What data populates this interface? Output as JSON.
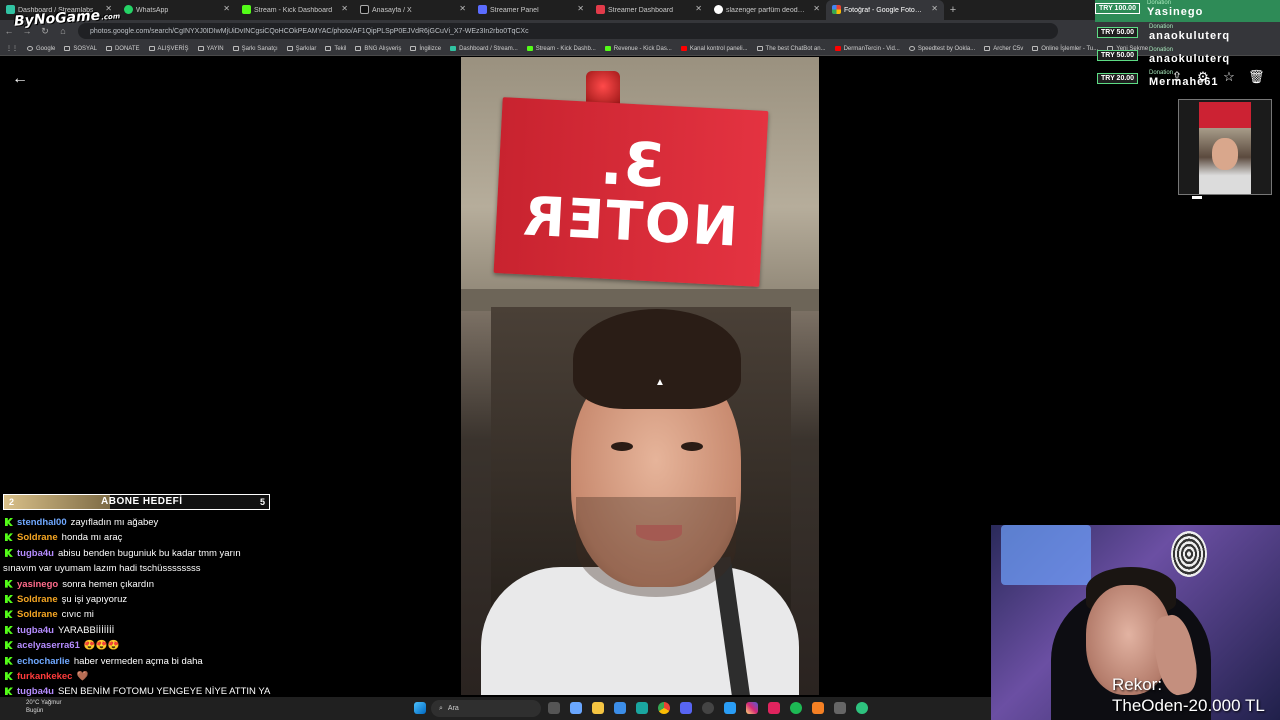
{
  "browser": {
    "tabs": [
      {
        "label": "Dashboard / Streamlabs",
        "icon": "streamlabs-icon",
        "color": "#31c3a2"
      },
      {
        "label": "WhatsApp",
        "icon": "whatsapp-icon",
        "color": "#25d366"
      },
      {
        "label": "Stream - Kick Dashboard",
        "icon": "kick-icon",
        "color": "#53fc18"
      },
      {
        "label": "Anasayfa / X",
        "icon": "x-icon",
        "color": "#ffffff"
      },
      {
        "label": "Streamer Panel",
        "icon": "panel-icon",
        "color": "#5b6cff"
      },
      {
        "label": "Streamer Dashboard",
        "icon": "dashboard-icon",
        "color": "#e23b4a"
      },
      {
        "label": "slazenger parfüm deodorant y",
        "icon": "google-icon",
        "color": "#8ab4f8"
      },
      {
        "label": "Fotoğraf - Google Fotoğraflar",
        "icon": "photos-icon",
        "color": "#fbbc04",
        "active": true
      }
    ],
    "url": "photos.google.com/search/CgINYXJ0IDIwMjUiDvINCgsiCQoHCOkPEAMYAC/photo/AF1QipPLSpP0EJVdR6jGCuVi_X7-WEz3In2rbo0TqCXc",
    "bookmarks": [
      "Google",
      "SOSYAL",
      "DONATE",
      "ALIŞVERİŞ",
      "YAYIN",
      "Şarkı Sanatçı",
      "Şarkılar",
      "Tekil",
      "BNG Alışveriş",
      "İngilizce",
      "Dashboard / Stream...",
      "Stream - Kick Dashb...",
      "Revenue - Kick Das...",
      "Kanal kontrol paneli...",
      "The best ChatBot an...",
      "DermanTercin - Vid...",
      "Speedtest by Ookla...",
      "Archer C5v",
      "Online İşlemler - Tu...",
      "Yeni Sekme"
    ]
  },
  "photo": {
    "sign_number": "3.",
    "sign_word": "NOTER"
  },
  "overlay": {
    "logo": "ByNoGame",
    "logo_sub": ".com",
    "donations": [
      {
        "amount": "TRY 100.00",
        "tag": "Donation",
        "name": "Yasinego"
      },
      {
        "amount": "TRY 50.00",
        "tag": "Donation",
        "name": "anaokuluterq"
      },
      {
        "amount": "TRY 50.00",
        "tag": "Donation",
        "name": "anaokuluterq"
      },
      {
        "amount": "TRY 20.00",
        "tag": "Donation",
        "name": "Mermahe61"
      }
    ],
    "goal": {
      "title": "ABONE HEDEFİ",
      "current": "2",
      "target": "5",
      "progress": 0.4
    },
    "chat": [
      {
        "user": "stendhal00",
        "color": "#6fa8ff",
        "text": "zayıfladın mı ağabey"
      },
      {
        "user": "Soldrane",
        "color": "#f5a623",
        "text": "honda mı araç"
      },
      {
        "user": "tugba4u",
        "color": "#b58cff",
        "text": "abisu benden buguniuk bu kadar tmm yarın sınavım var uyumam lazım hadi tschüssssssss"
      },
      {
        "user": "yasinego",
        "color": "#ff6b8a",
        "text": "sonra hemen çıkardın"
      },
      {
        "user": "Soldrane",
        "color": "#f5a623",
        "text": "şu işi yapıyoruz"
      },
      {
        "user": "Soldrane",
        "color": "#f5a623",
        "text": "cıvıc mi"
      },
      {
        "user": "tugba4u",
        "color": "#b58cff",
        "text": "YARABBİİİİİİİ"
      },
      {
        "user": "acelyaserra61",
        "color": "#b58cff",
        "text": "😍😍😍"
      },
      {
        "user": "echocharlie",
        "color": "#6fa8ff",
        "text": "haber vermeden açma bi daha"
      },
      {
        "user": "furkankekec",
        "color": "#ff3b3b",
        "text": "🤎"
      },
      {
        "user": "tugba4u",
        "color": "#b58cff",
        "text": "SEN BENİM FOTOMU YENGEYE NİYE ATTIN YA"
      }
    ],
    "rekor_label": "Rekor:",
    "rekor_value": "TheOden-20.000 TL"
  },
  "taskbar": {
    "weather_line1": "20°C Yağmur",
    "weather_line2": "Bugün",
    "search_placeholder": "Ara"
  }
}
